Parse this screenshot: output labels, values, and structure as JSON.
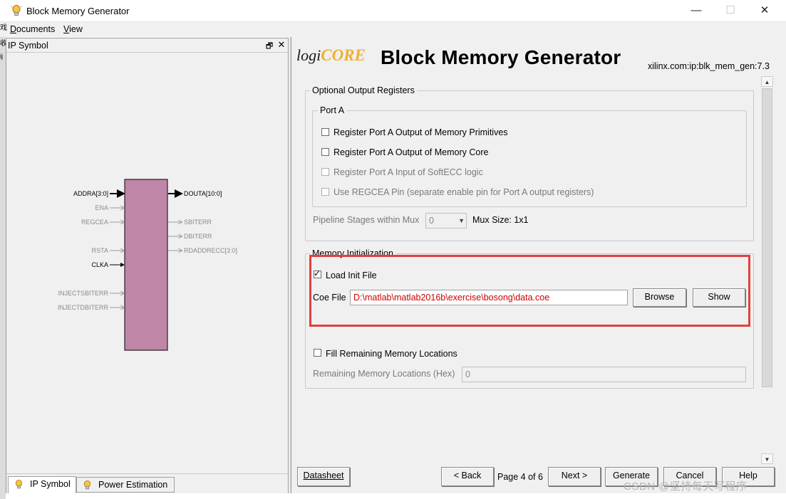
{
  "window": {
    "title": "Block Memory Generator",
    "controls": {
      "minimize": "—",
      "maximize": "☐",
      "close": "✕"
    }
  },
  "menu": [
    {
      "label": "Documents",
      "mnemonic": "D",
      "rest": "ocuments"
    },
    {
      "label": "View",
      "mnemonic": "V",
      "rest": "iew"
    }
  ],
  "left_strip_chars": [
    "戏",
    "收",
    "ij"
  ],
  "ip_panel": {
    "title": "IP Symbol",
    "restore_icon": "🗗",
    "close_icon": "✕",
    "block_color": "#c086a8",
    "left_pins": [
      {
        "label": "ADDRA[3:0]",
        "active": true,
        "bus": true
      },
      {
        "label": "ENA",
        "active": false,
        "bus": false
      },
      {
        "label": "REGCEA",
        "active": false,
        "bus": false
      },
      {
        "label": "RSTA",
        "active": false,
        "bus": false
      },
      {
        "label": "CLKA",
        "active": true,
        "bus": false
      },
      {
        "label": "INJECTSBITERR",
        "active": false,
        "bus": false
      },
      {
        "label": "INJECTDBITERR",
        "active": false,
        "bus": false
      }
    ],
    "right_pins": [
      {
        "label": "DOUTA[10:0]",
        "active": true,
        "bus": true
      },
      {
        "label": "SBITERR",
        "active": false,
        "bus": false
      },
      {
        "label": "DBITERR",
        "active": false,
        "bus": false
      },
      {
        "label": "RDADDRECC[3:0]",
        "active": false,
        "bus": true
      }
    ],
    "tabs": [
      {
        "label": "IP Symbol",
        "active": true,
        "icon": "bulb-icon"
      },
      {
        "label": "Power Estimation",
        "active": false,
        "icon": "bulb-icon"
      }
    ]
  },
  "right_panel": {
    "logo_part1": "logi",
    "logo_part2": "CORE",
    "title": "Block Memory Generator",
    "core_id": "xilinx.com:ip:blk_mem_gen:7.3",
    "optional_output": {
      "legend": "Optional Output Registers",
      "port_a": {
        "legend": "Port A",
        "options": [
          {
            "label": "Register Port A Output of Memory Primitives",
            "checked": false,
            "enabled": true
          },
          {
            "label": "Register Port A Output of Memory Core",
            "checked": false,
            "enabled": true
          },
          {
            "label": "Register Port A Input of SoftECC logic",
            "checked": false,
            "enabled": false
          },
          {
            "label": "Use REGCEA Pin (separate enable pin for Port A output registers)",
            "checked": false,
            "enabled": false
          }
        ]
      },
      "pipeline_label": "Pipeline Stages within Mux",
      "pipeline_value": "0",
      "mux_size": "Mux Size: 1x1"
    },
    "memory_init": {
      "legend": "Memory Initialization",
      "load_init_label": "Load Init File",
      "load_init_checked": true,
      "coe_label": "Coe File",
      "coe_value": "D:\\matlab\\matlab2016b\\exercise\\bosong\\data.coe",
      "browse_label": "Browse",
      "show_label": "Show",
      "fill_remaining_label": "Fill Remaining Memory Locations",
      "fill_remaining_checked": false,
      "remaining_label": "Remaining Memory Locations (Hex)",
      "remaining_value": "0"
    },
    "nav": {
      "datasheet": "Datasheet",
      "back": "< Back",
      "page": "Page 4 of 6",
      "next": "Next >",
      "generate": "Generate",
      "cancel": "Cancel",
      "help": "Help"
    }
  },
  "watermark": "CSDN @坚持每天写程序",
  "colors": {
    "highlight": "#e04040",
    "coe_text": "#cc0000"
  }
}
